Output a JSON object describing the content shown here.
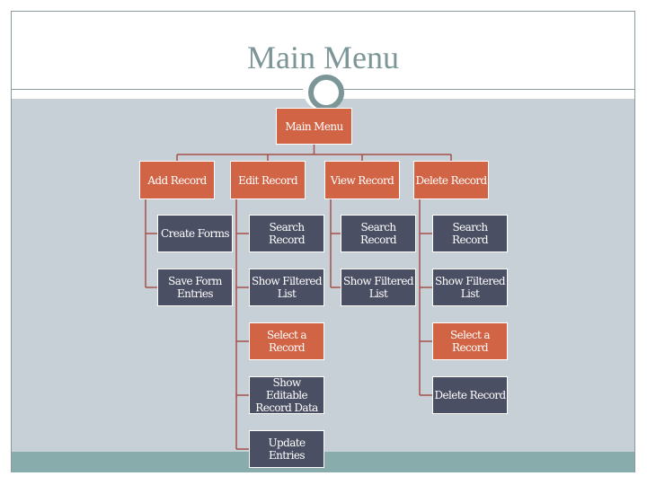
{
  "slide": {
    "title": "Main Menu"
  },
  "colors": {
    "level_box": "#d26446",
    "leaf_box": "#4b4f63",
    "connector": "#a5504a",
    "background": "#c6d0d6",
    "accent": "#7c9596",
    "footer": "#88abab"
  },
  "chart": {
    "root": {
      "label": "Main Menu"
    },
    "branches": [
      {
        "label": "Add Record",
        "children": [
          {
            "label": "Create Forms",
            "style": "navy"
          },
          {
            "label": "Save Form Entries",
            "style": "navy"
          }
        ]
      },
      {
        "label": "Edit Record",
        "children": [
          {
            "label": "Search Record",
            "style": "navy"
          },
          {
            "label": "Show Filtered List",
            "style": "navy"
          },
          {
            "label": "Select a Record",
            "style": "orange"
          },
          {
            "label": "Show Editable Record Data",
            "style": "navy"
          },
          {
            "label": "Update Entries",
            "style": "navy"
          }
        ]
      },
      {
        "label": "View Record",
        "children": [
          {
            "label": "Search Record",
            "style": "navy"
          },
          {
            "label": "Show Filtered List",
            "style": "navy"
          }
        ]
      },
      {
        "label": "Delete Record",
        "children": [
          {
            "label": "Search Record",
            "style": "navy"
          },
          {
            "label": "Show Filtered List",
            "style": "navy"
          },
          {
            "label": "Select a Record",
            "style": "orange"
          },
          {
            "label": "Delete Record",
            "style": "navy"
          }
        ]
      }
    ]
  }
}
